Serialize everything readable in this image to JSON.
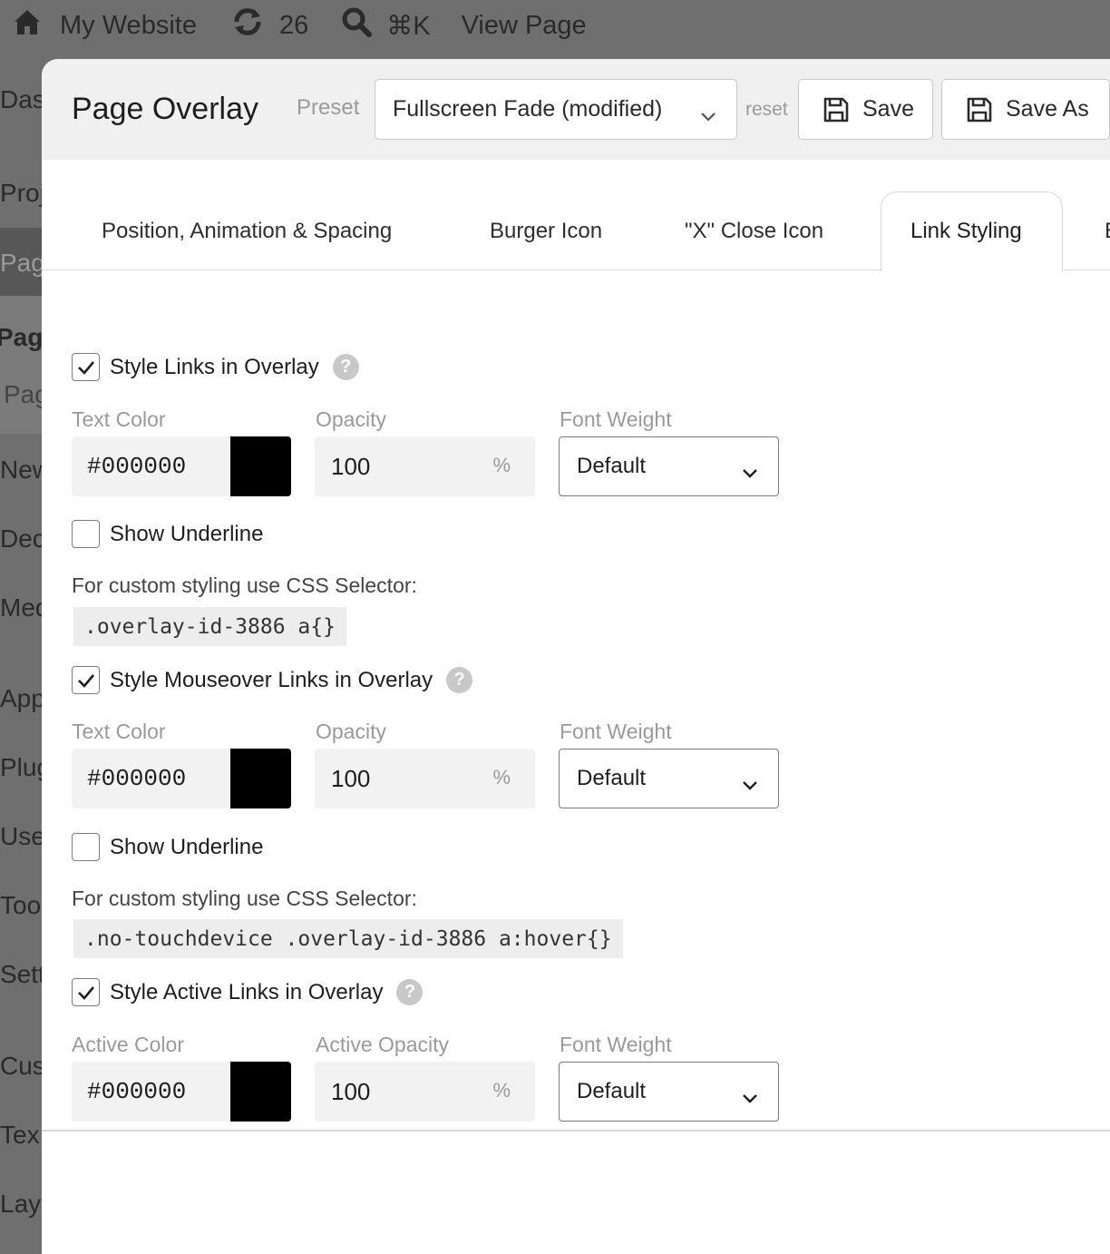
{
  "admin_bar": {
    "site_name": "My Website",
    "updates_count": "26",
    "search_shortcut": "⌘K",
    "view_page": "View Page"
  },
  "background_sidebar": {
    "items": [
      "Das",
      "Proj",
      "Pag",
      "Page",
      "Pag",
      "New",
      "Dec",
      "Med",
      "App",
      "Plug",
      "Use",
      "Too",
      "Sett",
      "Cus",
      "Tex",
      "Lay"
    ]
  },
  "modal": {
    "title": "Page Overlay",
    "preset_label": "Preset",
    "preset_value": "Fullscreen Fade (modified)",
    "reset_label": "reset",
    "save_label": "Save",
    "save_as_label": "Save As",
    "tabs": [
      {
        "label": "Position, Animation & Spacing"
      },
      {
        "label": "Burger Icon"
      },
      {
        "label": "\"X\" Close Icon"
      },
      {
        "label": "Link Styling"
      },
      {
        "label": "E"
      }
    ],
    "active_tab": "Link Styling"
  },
  "sections": [
    {
      "checkbox_label": "Style Links in Overlay",
      "checked": true,
      "color_label": "Text Color",
      "color_value": "#000000",
      "opacity_label": "Opacity",
      "opacity_value": "100",
      "opacity_unit": "%",
      "weight_label": "Font Weight",
      "weight_value": "Default",
      "underline_label": "Show Underline",
      "underline_checked": false,
      "hint": "For custom styling use CSS Selector:",
      "selector": ".overlay-id-3886 a{}"
    },
    {
      "checkbox_label": "Style Mouseover Links in Overlay",
      "checked": true,
      "color_label": "Text Color",
      "color_value": "#000000",
      "opacity_label": "Opacity",
      "opacity_value": "100",
      "opacity_unit": "%",
      "weight_label": "Font Weight",
      "weight_value": "Default",
      "underline_label": "Show Underline",
      "underline_checked": false,
      "hint": "For custom styling use CSS Selector:",
      "selector": ".no-touchdevice .overlay-id-3886 a:hover{}"
    },
    {
      "checkbox_label": "Style Active Links in Overlay",
      "checked": true,
      "color_label": "Active Color",
      "color_value": "#000000",
      "opacity_label": "Active Opacity",
      "opacity_value": "100",
      "opacity_unit": "%",
      "weight_label": "Font Weight",
      "weight_value": "Default"
    }
  ],
  "colors": {
    "backdrop": "#6f6f6f",
    "header_bg": "#f0f0f0",
    "swatch": "#000000",
    "muted_text": "#9a9a9a"
  },
  "icons": [
    "home-icon",
    "refresh-icon",
    "search-icon",
    "chevron-down-icon",
    "save-icon",
    "check-icon",
    "help-icon"
  ]
}
